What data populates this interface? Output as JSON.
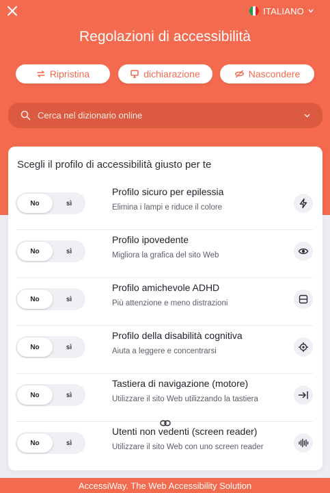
{
  "header": {
    "close_icon": "close-icon",
    "language": {
      "label": "ITALIANO",
      "flag_icon": "italy-flag-icon",
      "chevron_icon": "chevron-down-icon"
    },
    "title": "Regolazioni di accessibilità"
  },
  "actions": {
    "reset": {
      "label": "Ripristina",
      "icon": "refresh-icon"
    },
    "statement": {
      "label": "dichiarazione",
      "icon": "monitor-icon"
    },
    "hide": {
      "label": "Nascondere",
      "icon": "eye-off-icon"
    }
  },
  "search": {
    "placeholder": "Cerca nel dizionario online",
    "icon": "search-icon",
    "chevron_icon": "chevron-down-icon"
  },
  "profiles": {
    "title": "Scegli il profilo di accessibilità giusto per te",
    "toggle_off": "No",
    "toggle_on": "sì",
    "items": [
      {
        "title": "Profilo sicuro per epilessia",
        "desc": "Elimina i lampi e riduce il colore",
        "icon": "bolt-icon"
      },
      {
        "title": "Profilo ipovedente",
        "desc": "Migliora la grafica del sito Web",
        "icon": "eye-icon"
      },
      {
        "title": "Profilo amichevole ADHD",
        "desc": "Più attenzione e meno distrazioni",
        "icon": "focus-frame-icon"
      },
      {
        "title": "Profilo della disabilità cognitiva",
        "desc": "Aiuta a leggere e concentrarsi",
        "icon": "target-icon"
      },
      {
        "title": "Tastiera di navigazione (motore)",
        "desc": "Utilizzare il sito Web utilizzando la tastiera",
        "icon": "arrow-to-end-icon"
      },
      {
        "title": "Utenti non vedenti (screen reader)",
        "desc": "Utilizzare il sito Web con uno screen reader",
        "icon": "audio-wave-icon"
      }
    ]
  },
  "link_icon": "link-icon",
  "footer": {
    "text": "AccessiWay. The Web Accessibility Solution"
  },
  "colors": {
    "accent": "#f46a4e",
    "search_bg": "#dc5a42",
    "page_bg": "#eceef4",
    "card_bg": "#ffffff"
  }
}
